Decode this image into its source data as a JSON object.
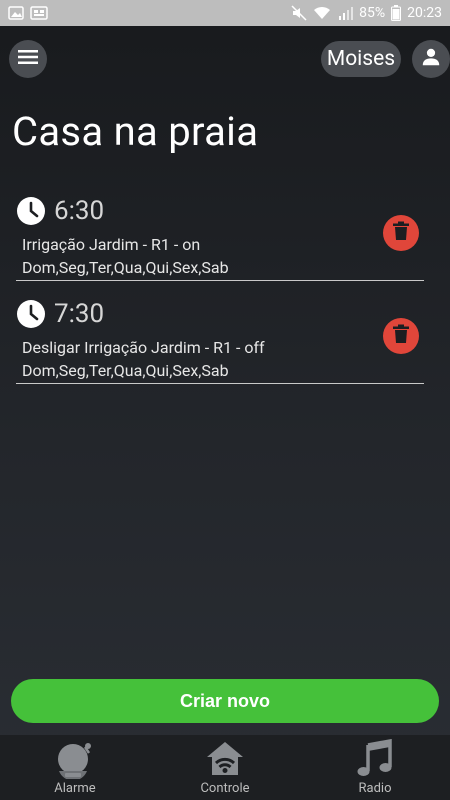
{
  "status_bar": {
    "battery_percent": "85%",
    "time": "20:23"
  },
  "header": {
    "user_name": "Moises"
  },
  "page": {
    "title": "Casa na praia"
  },
  "alarms": [
    {
      "time": "6:30",
      "description": "Irrigação Jardim - R1 - on",
      "days": "Dom,Seg,Ter,Qua,Qui,Sex,Sab"
    },
    {
      "time": "7:30",
      "description": "Desligar Irrigação Jardim - R1 - off",
      "days": "Dom,Seg,Ter,Qua,Qui,Sex,Sab"
    }
  ],
  "create_button": {
    "label": "Criar novo"
  },
  "bottom_nav": [
    {
      "label": "Alarme",
      "icon": "bell-icon"
    },
    {
      "label": "Controle",
      "icon": "wifi-home-icon"
    },
    {
      "label": "Radio",
      "icon": "music-note-icon"
    }
  ],
  "colors": {
    "delete": "#e0463a",
    "create": "#45c13a",
    "pill_bg": "#4a4d52"
  }
}
